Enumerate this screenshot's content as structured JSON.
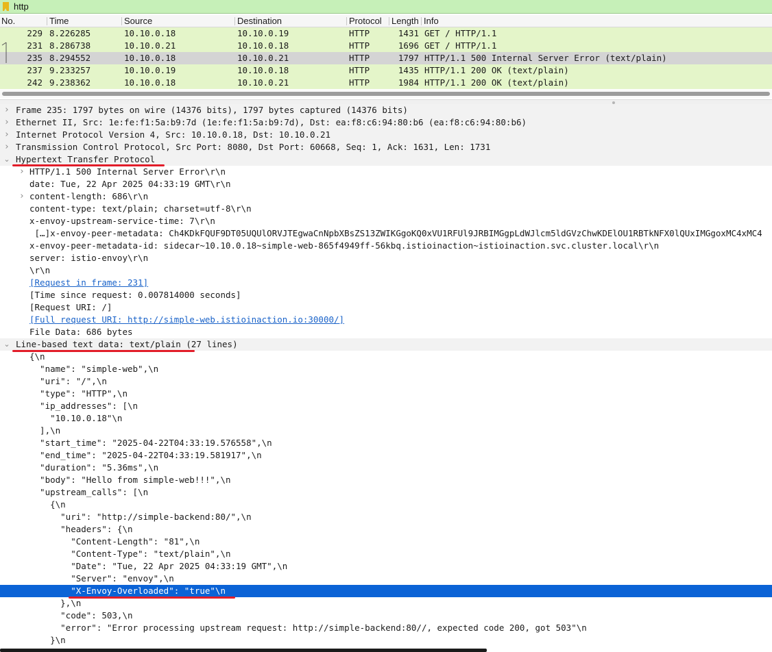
{
  "filter": {
    "value": "http",
    "placeholder": ""
  },
  "packet_list": {
    "columns": [
      "No.",
      "Time",
      "Source",
      "Destination",
      "Protocol",
      "Length",
      "Info"
    ],
    "rows": [
      {
        "no": "229",
        "time": "8.226285",
        "source": "10.10.0.18",
        "destination": "10.10.0.19",
        "protocol": "HTTP",
        "length": "1431",
        "info": "GET / HTTP/1.1",
        "selected": false
      },
      {
        "no": "231",
        "time": "8.286738",
        "source": "10.10.0.21",
        "destination": "10.10.0.18",
        "protocol": "HTTP",
        "length": "1696",
        "info": "GET / HTTP/1.1",
        "selected": false
      },
      {
        "no": "235",
        "time": "8.294552",
        "source": "10.10.0.18",
        "destination": "10.10.0.21",
        "protocol": "HTTP",
        "length": "1797",
        "info": "HTTP/1.1 500 Internal Server Error  (text/plain)",
        "selected": true
      },
      {
        "no": "237",
        "time": "9.233257",
        "source": "10.10.0.19",
        "destination": "10.10.0.18",
        "protocol": "HTTP",
        "length": "1435",
        "info": "HTTP/1.1 200 OK  (text/plain)",
        "selected": false
      },
      {
        "no": "242",
        "time": "9.238362",
        "source": "10.10.0.18",
        "destination": "10.10.0.21",
        "protocol": "HTTP",
        "length": "1984",
        "info": "HTTP/1.1 200 OK  (text/plain)",
        "selected": false
      }
    ]
  },
  "details": [
    {
      "text": "Frame 235: 1797 bytes on wire (14376 bits), 1797 bytes captured (14376 bits)",
      "level": 0,
      "toggle": "collapsed",
      "kind": "top"
    },
    {
      "text": "Ethernet II, Src: 1e:fe:f1:5a:b9:7d (1e:fe:f1:5a:b9:7d), Dst: ea:f8:c6:94:80:b6 (ea:f8:c6:94:80:b6)",
      "level": 0,
      "toggle": "collapsed",
      "kind": "top"
    },
    {
      "text": "Internet Protocol Version 4, Src: 10.10.0.18, Dst: 10.10.0.21",
      "level": 0,
      "toggle": "collapsed",
      "kind": "top"
    },
    {
      "text": "Transmission Control Protocol, Src Port: 8080, Dst Port: 60668, Seq: 1, Ack: 1631, Len: 1731",
      "level": 0,
      "toggle": "collapsed",
      "kind": "top"
    },
    {
      "text": "Hypertext Transfer Protocol",
      "level": 0,
      "toggle": "expanded",
      "kind": "top"
    },
    {
      "text": "HTTP/1.1 500 Internal Server Error\\r\\n",
      "level": 1,
      "toggle": "collapsed",
      "kind": ""
    },
    {
      "text": "date: Tue, 22 Apr 2025 04:33:19 GMT\\r\\n",
      "level": 1,
      "toggle": "",
      "kind": ""
    },
    {
      "text": "content-length: 686\\r\\n",
      "level": 1,
      "toggle": "collapsed",
      "kind": ""
    },
    {
      "text": "content-type: text/plain; charset=utf-8\\r\\n",
      "level": 1,
      "toggle": "",
      "kind": ""
    },
    {
      "text": "x-envoy-upstream-service-time: 7\\r\\n",
      "level": 1,
      "toggle": "",
      "kind": ""
    },
    {
      "text": " […]x-envoy-peer-metadata: Ch4KDkFQUF9DT05UQUlORVJTEgwaCnNpbXBsZS13ZWIKGgoKQ0xVU1RFUl9JRBIMGgpLdWJlcm5ldGVzChwKDElOU1RBTkNFX0lQUxIMGgoxMC4xMC4",
      "level": 1,
      "toggle": "",
      "kind": ""
    },
    {
      "text": "x-envoy-peer-metadata-id: sidecar~10.10.0.18~simple-web-865f4949ff-56kbq.istioinaction~istioinaction.svc.cluster.local\\r\\n",
      "level": 1,
      "toggle": "",
      "kind": ""
    },
    {
      "text": "server: istio-envoy\\r\\n",
      "level": 1,
      "toggle": "",
      "kind": ""
    },
    {
      "text": "\\r\\n",
      "level": 1,
      "toggle": "",
      "kind": ""
    },
    {
      "text": "[Request in frame: 231]",
      "level": 1,
      "toggle": "",
      "kind": "link"
    },
    {
      "text": "[Time since request: 0.007814000 seconds]",
      "level": 1,
      "toggle": "",
      "kind": ""
    },
    {
      "text": "[Request URI: /]",
      "level": 1,
      "toggle": "",
      "kind": ""
    },
    {
      "text": "[Full request URI: http://simple-web.istioinaction.io:30000/]",
      "level": 1,
      "toggle": "",
      "kind": "link"
    },
    {
      "text": "File Data: 686 bytes",
      "level": 1,
      "toggle": "",
      "kind": ""
    },
    {
      "text": "Line-based text data: text/plain (27 lines)",
      "level": 0,
      "toggle": "expanded",
      "kind": "top"
    },
    {
      "text": "{\\n",
      "level": 1,
      "toggle": "",
      "kind": ""
    },
    {
      "text": "  \"name\": \"simple-web\",\\n",
      "level": 1,
      "toggle": "",
      "kind": ""
    },
    {
      "text": "  \"uri\": \"/\",\\n",
      "level": 1,
      "toggle": "",
      "kind": ""
    },
    {
      "text": "  \"type\": \"HTTP\",\\n",
      "level": 1,
      "toggle": "",
      "kind": ""
    },
    {
      "text": "  \"ip_addresses\": [\\n",
      "level": 1,
      "toggle": "",
      "kind": ""
    },
    {
      "text": "    \"10.10.0.18\"\\n",
      "level": 1,
      "toggle": "",
      "kind": ""
    },
    {
      "text": "  ],\\n",
      "level": 1,
      "toggle": "",
      "kind": ""
    },
    {
      "text": "  \"start_time\": \"2025-04-22T04:33:19.576558\",\\n",
      "level": 1,
      "toggle": "",
      "kind": ""
    },
    {
      "text": "  \"end_time\": \"2025-04-22T04:33:19.581917\",\\n",
      "level": 1,
      "toggle": "",
      "kind": ""
    },
    {
      "text": "  \"duration\": \"5.36ms\",\\n",
      "level": 1,
      "toggle": "",
      "kind": ""
    },
    {
      "text": "  \"body\": \"Hello from simple-web!!!\",\\n",
      "level": 1,
      "toggle": "",
      "kind": ""
    },
    {
      "text": "  \"upstream_calls\": [\\n",
      "level": 1,
      "toggle": "",
      "kind": ""
    },
    {
      "text": "    {\\n",
      "level": 1,
      "toggle": "",
      "kind": ""
    },
    {
      "text": "      \"uri\": \"http://simple-backend:80/\",\\n",
      "level": 1,
      "toggle": "",
      "kind": ""
    },
    {
      "text": "      \"headers\": {\\n",
      "level": 1,
      "toggle": "",
      "kind": ""
    },
    {
      "text": "        \"Content-Length\": \"81\",\\n",
      "level": 1,
      "toggle": "",
      "kind": ""
    },
    {
      "text": "        \"Content-Type\": \"text/plain\",\\n",
      "level": 1,
      "toggle": "",
      "kind": ""
    },
    {
      "text": "        \"Date\": \"Tue, 22 Apr 2025 04:33:19 GMT\",\\n",
      "level": 1,
      "toggle": "",
      "kind": ""
    },
    {
      "text": "        \"Server\": \"envoy\",\\n",
      "level": 1,
      "toggle": "",
      "kind": ""
    },
    {
      "text": "        \"X-Envoy-Overloaded\": \"true\"\\n",
      "level": 1,
      "toggle": "",
      "kind": "selected"
    },
    {
      "text": "      },\\n",
      "level": 1,
      "toggle": "",
      "kind": ""
    },
    {
      "text": "      \"code\": 503,\\n",
      "level": 1,
      "toggle": "",
      "kind": ""
    },
    {
      "text": "      \"error\": \"Error processing upstream request: http://simple-backend:80//, expected code 200, got 503\"\\n",
      "level": 1,
      "toggle": "",
      "kind": ""
    },
    {
      "text": "    }\\n",
      "level": 1,
      "toggle": "",
      "kind": ""
    }
  ],
  "colors": {
    "filter_bg": "#c6f0b8",
    "http_row": "#e4f5c9",
    "selected_row": "#d4d4d4",
    "selection_blue": "#0b63d6",
    "link": "#1a63c9",
    "annotation_red": "#e21d2a"
  }
}
